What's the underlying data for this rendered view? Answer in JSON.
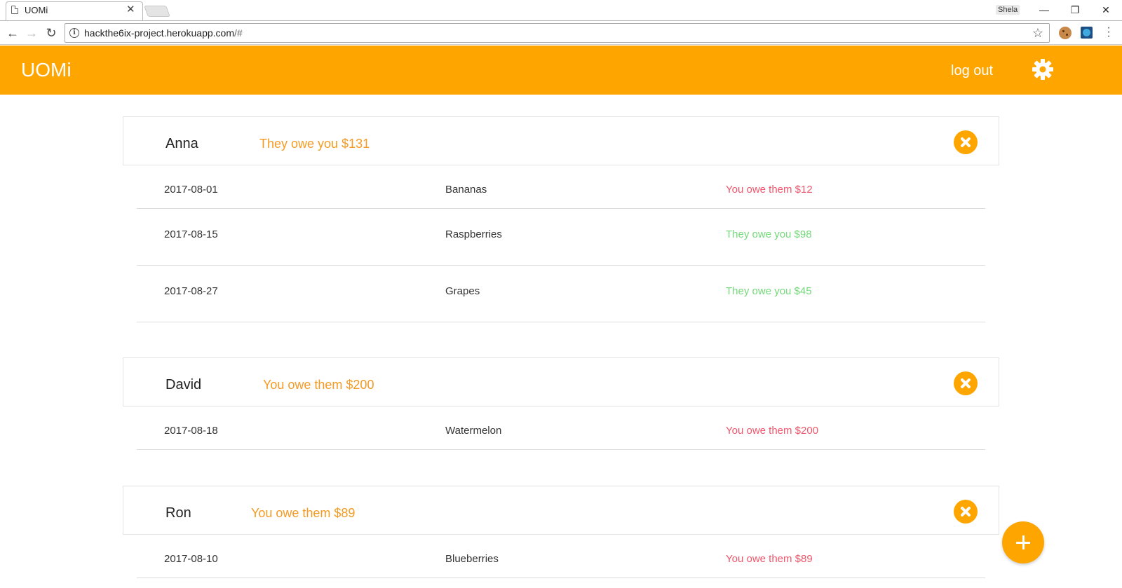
{
  "browser": {
    "tab_title": "UOMi",
    "profile_name": "Shela",
    "url_host": "hackthe6ix-project.herokuapp.com",
    "url_path": "/#"
  },
  "header": {
    "app_title": "UOMi",
    "logout_label": "log out"
  },
  "groups": [
    {
      "person": "Anna",
      "total": "They owe you $131",
      "rows": [
        {
          "date": "2017-08-01",
          "item": "Bananas",
          "amount": "You owe them $12",
          "direction": "owe-them"
        },
        {
          "date": "2017-08-15",
          "item": "Raspberries",
          "amount": "They owe you $98",
          "direction": "owe-you"
        },
        {
          "date": "2017-08-27",
          "item": "Grapes",
          "amount": "They owe you $45",
          "direction": "owe-you"
        }
      ]
    },
    {
      "person": "David",
      "total": "You owe them $200",
      "rows": [
        {
          "date": "2017-08-18",
          "item": "Watermelon",
          "amount": "You owe them $200",
          "direction": "owe-them"
        }
      ]
    },
    {
      "person": "Ron",
      "total": "You owe them $89",
      "rows": [
        {
          "date": "2017-08-10",
          "item": "Blueberries",
          "amount": "You owe them $89",
          "direction": "owe-them"
        }
      ]
    }
  ],
  "colors": {
    "brand": "#ffa500",
    "owe_them": "#f0566b",
    "owe_you": "#73d97a"
  }
}
